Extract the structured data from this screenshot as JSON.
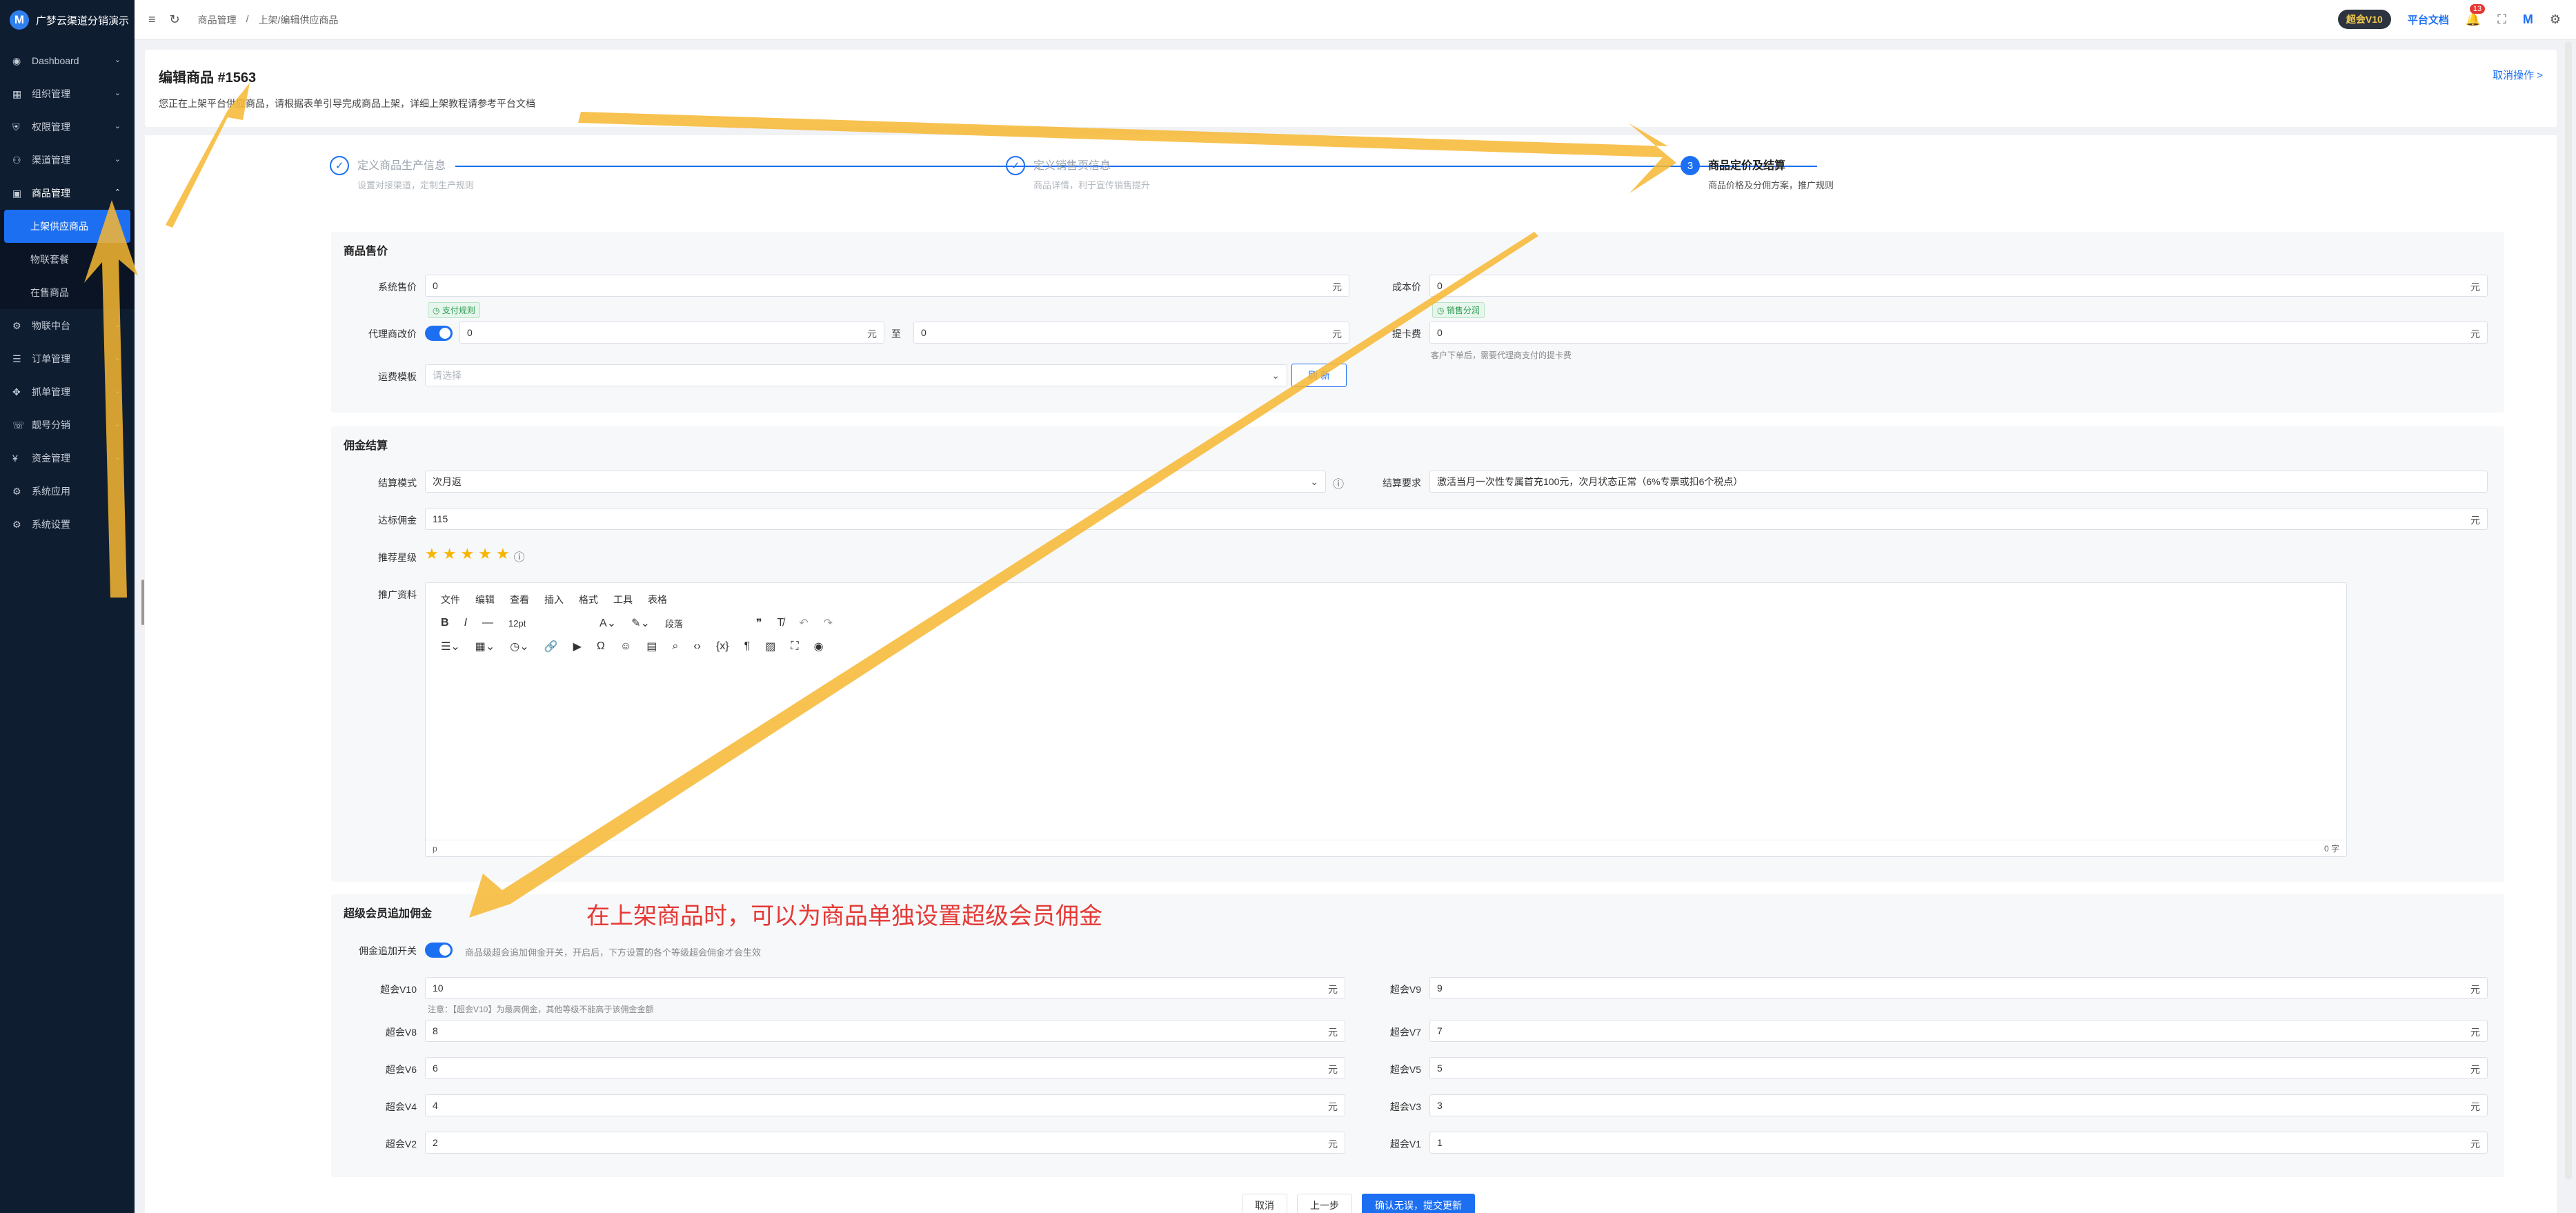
{
  "app": {
    "name": "广梦云渠道分销演示"
  },
  "sidebar": {
    "items": [
      {
        "label": "Dashboard",
        "icon": "dashboard-icon"
      },
      {
        "label": "组织管理",
        "icon": "org-icon"
      },
      {
        "label": "权限管理",
        "icon": "permission-icon"
      },
      {
        "label": "渠道管理",
        "icon": "channel-icon"
      },
      {
        "label": "商品管理",
        "icon": "goods-icon"
      },
      {
        "label": "物联中台",
        "icon": "iot-icon"
      },
      {
        "label": "订单管理",
        "icon": "order-icon"
      },
      {
        "label": "抓单管理",
        "icon": "grab-icon"
      },
      {
        "label": "靓号分销",
        "icon": "number-icon"
      },
      {
        "label": "资金管理",
        "icon": "fund-icon"
      },
      {
        "label": "系统应用",
        "icon": "app-icon"
      },
      {
        "label": "系统设置",
        "icon": "settings-icon"
      }
    ],
    "submenu": [
      "上架供应商品",
      "物联套餐",
      "在售商品"
    ]
  },
  "topbar": {
    "breadcrumb": [
      "商品管理",
      "/",
      "上架/编辑供应商品"
    ],
    "vip": "超会V10",
    "doc": "平台文档",
    "notice_count": "13"
  },
  "header": {
    "title": "编辑商品 #1563",
    "desc": "您正在上架平台供应商品，请根据表单引导完成商品上架，详细上架教程请参考平台文档",
    "cancel": "取消操作 >"
  },
  "steps": [
    {
      "title": "定义商品生产信息",
      "sub": "设置对接渠道，定制生产规则"
    },
    {
      "title": "定义销售页信息",
      "sub": "商品详情，利于宣传销售提升"
    },
    {
      "num": "3",
      "title": "商品定价及结算",
      "sub": "商品价格及分佣方案，推广规则"
    }
  ],
  "pricing": {
    "title": "商品售价",
    "sys_price_label": "系统售价",
    "sys_price": "0",
    "unit": "元",
    "sys_tag": "支付规则",
    "cost_label": "成本价",
    "cost": "0",
    "cost_tag": "销售分润",
    "agent_label": "代理商改价",
    "agent_min": "0",
    "to": "至",
    "agent_max": "0",
    "card_fee_label": "提卡费",
    "card_fee": "0",
    "card_fee_hint": "客户下单后，需要代理商支付的提卡费",
    "freight_label": "运费模板",
    "freight_placeholder": "请选择",
    "freight_btn": "刷 新"
  },
  "commission": {
    "title": "佣金结算",
    "mode_label": "结算模式",
    "mode": "次月返",
    "req_label": "结算要求",
    "req": "激活当月一次性专属首充100元，次月状态正常（6%专票或扣6个税点）",
    "reach_label": "达标佣金",
    "reach": "115",
    "star_label": "推荐星级",
    "stars": 5,
    "promo_label": "推广资料",
    "editor_menu": [
      "文件",
      "编辑",
      "查看",
      "插入",
      "格式",
      "工具",
      "表格"
    ],
    "font_size": "12pt",
    "paragraph": "段落",
    "editor_path": "p",
    "editor_count": "0 字"
  },
  "vip_section": {
    "title": "超级会员追加佣金",
    "switch_label": "佣金追加开关",
    "switch_hint": "商品级超会追加佣金开关，开启后，下方设置的各个等级超会佣金才会生效",
    "note": "注意：【超会V10】为最高佣金，其他等级不能高于该佣金金额",
    "levels": [
      {
        "label": "超会V10",
        "value": "10"
      },
      {
        "label": "超会V9",
        "value": "9"
      },
      {
        "label": "超会V8",
        "value": "8"
      },
      {
        "label": "超会V7",
        "value": "7"
      },
      {
        "label": "超会V6",
        "value": "6"
      },
      {
        "label": "超会V5",
        "value": "5"
      },
      {
        "label": "超会V4",
        "value": "4"
      },
      {
        "label": "超会V3",
        "value": "3"
      },
      {
        "label": "超会V2",
        "value": "2"
      },
      {
        "label": "超会V1",
        "value": "1"
      }
    ]
  },
  "footer": {
    "cancel": "取消",
    "prev": "上一步",
    "submit": "确认无误，提交更新"
  },
  "annotation": {
    "text": "在上架商品时，可以为商品单独设置超级会员佣金",
    "color": "#e53935",
    "arrow_color": "#f7b731"
  },
  "colors": {
    "sidebar": "#0f1d31",
    "accent": "#1d6ff2"
  }
}
